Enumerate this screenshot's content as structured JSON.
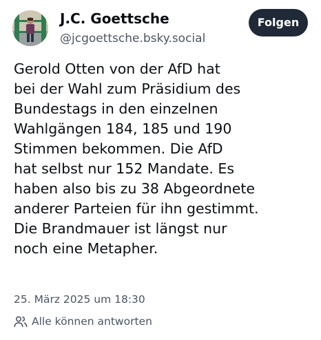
{
  "author": {
    "display_name": "J.C. Goettsche",
    "handle": "@jcgoettsche.bsky.social"
  },
  "follow_button": {
    "label": "Folgen"
  },
  "post": {
    "text_lines": [
      "Gerold Otten von der AfD hat",
      "bei der Wahl zum Präsidium des",
      "Bundestags in den einzelnen",
      "Wahlgängen 184, 185 und 190",
      "Stimmen bekommen. Die AfD",
      "hat selbst nur 152 Mandate. Es",
      "haben also bis zu 38 Abgeordnete",
      "anderer Parteien für ihn gestimmt.",
      "Die Brandmauer ist längst nur",
      "noch eine Metapher."
    ],
    "timestamp": "25. März 2025 um 18:30"
  },
  "reply_setting": {
    "icon": "people-icon",
    "label": "Alle können antworten"
  },
  "colors": {
    "text_primary": "#0b0f14",
    "text_secondary": "#4b5563",
    "button_bg": "#1f2937",
    "button_text": "#ffffff"
  }
}
